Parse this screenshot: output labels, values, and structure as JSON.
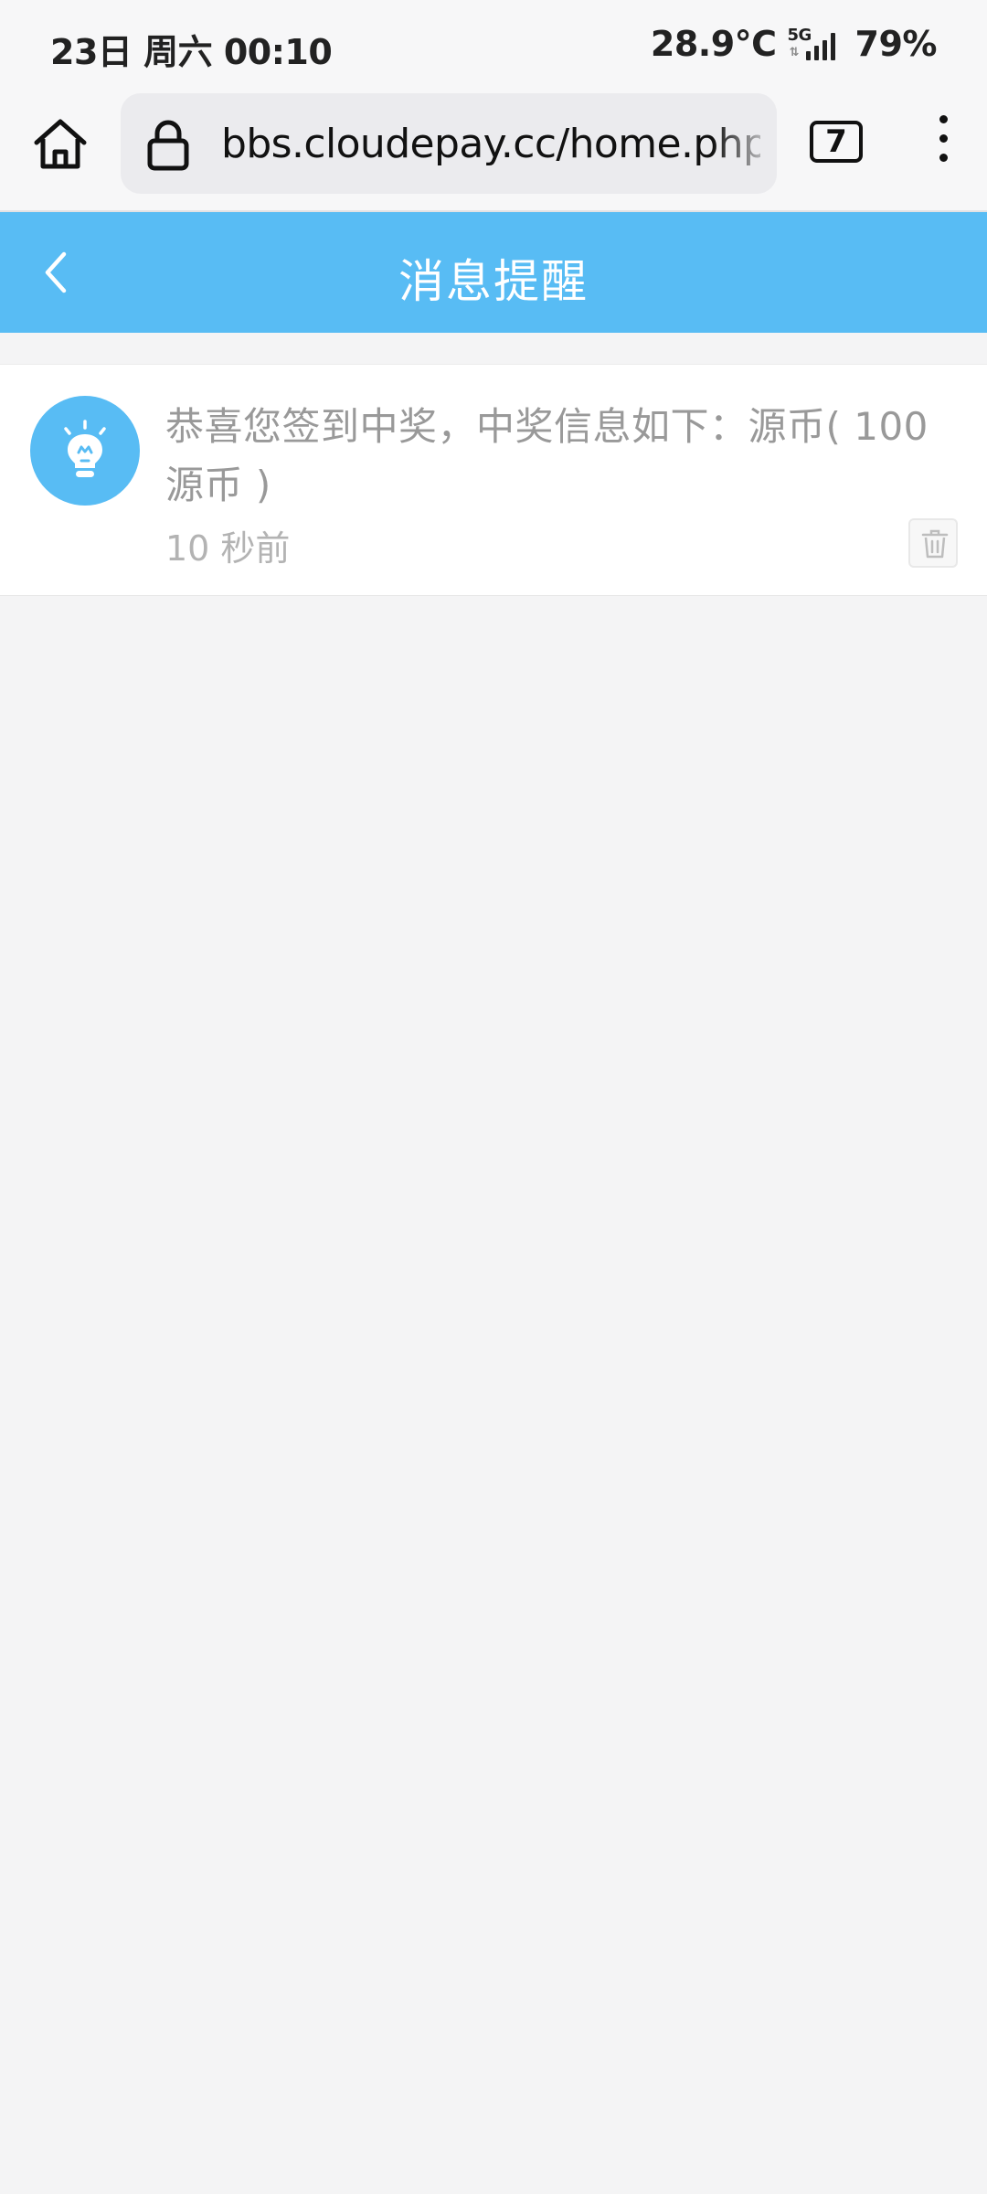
{
  "status_bar": {
    "datetime": "23日 周六 00:10",
    "temperature": "28.9°C",
    "network": "5G",
    "battery": "79%"
  },
  "browser": {
    "url": "bbs.cloudepay.cc/home.php?mod=space&do=notice",
    "tab_count": "7"
  },
  "header": {
    "title": "消息提醒"
  },
  "messages": [
    {
      "text": "恭喜您签到中奖，中奖信息如下：源币( 100源币 )",
      "time": "10 秒前",
      "icon": "lightbulb-icon"
    }
  ],
  "colors": {
    "accent": "#58bcf4",
    "background": "#f4f4f5",
    "message_text": "#999999",
    "time_text": "#b3b3b3"
  }
}
